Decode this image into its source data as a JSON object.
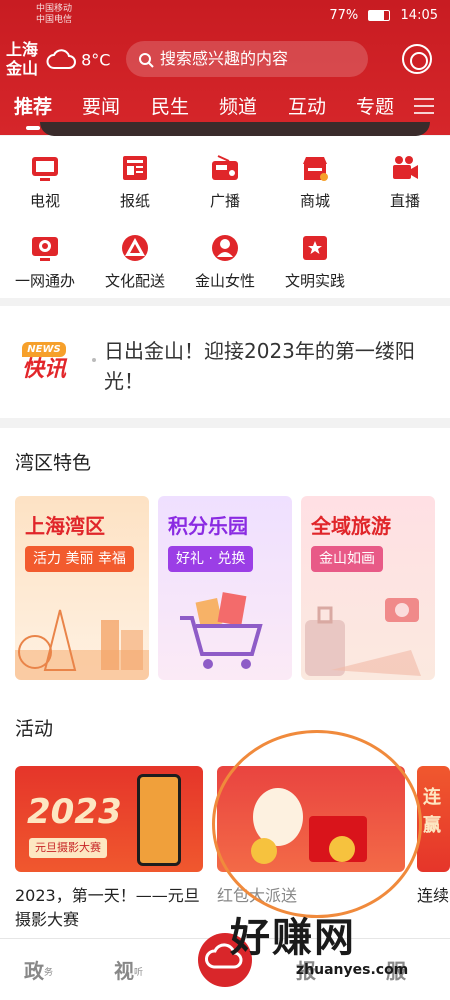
{
  "status_bar": {
    "carrier_1": "中国移动",
    "carrier_2": "中国电信",
    "battery": "77%",
    "time": "14:05"
  },
  "header": {
    "city": "上海金山",
    "temperature": "8°C",
    "weather_icon": "cloud-icon",
    "search_placeholder": "搜索感兴趣的内容"
  },
  "nav_tabs": [
    "推荐",
    "要闻",
    "民生",
    "频道",
    "互动",
    "专题"
  ],
  "grid": {
    "items": [
      {
        "label": "电视",
        "icon": "tv-icon"
      },
      {
        "label": "报纸",
        "icon": "newspaper-icon"
      },
      {
        "label": "广播",
        "icon": "radio-icon"
      },
      {
        "label": "商城",
        "icon": "shop-icon"
      },
      {
        "label": "直播",
        "icon": "camera-icon"
      },
      {
        "label": "一网通办",
        "icon": "service-icon"
      },
      {
        "label": "文化配送",
        "icon": "culture-icon"
      },
      {
        "label": "金山女性",
        "icon": "women-icon"
      },
      {
        "label": "文明实践",
        "icon": "practice-icon"
      }
    ]
  },
  "news": {
    "badge_top": "NEWS",
    "badge_main": "快讯",
    "headline": "日出金山！迎接2023年的第一缕阳光！"
  },
  "bay_section": {
    "title": "湾区特色",
    "tiles": [
      {
        "title": "上海湾区",
        "pill": "活力 美丽 幸福"
      },
      {
        "title": "积分乐园",
        "pill": "好礼 · 兑换"
      },
      {
        "title": "全域旅游",
        "pill": "金山如画"
      }
    ]
  },
  "activity_section": {
    "title": "活动",
    "items": [
      {
        "caption": "2023，第一天！——元旦摄影大赛",
        "banner_text": "2023",
        "banner_sub": "元旦摄影大赛"
      },
      {
        "caption": "红包大派送",
        "banner_text": ""
      },
      {
        "caption": "连续",
        "banner_text": "连赢"
      }
    ]
  },
  "bottom_bar": {
    "items": [
      {
        "label": "政",
        "sub": "务"
      },
      {
        "label": "视",
        "sub": "听"
      },
      {
        "label": "报",
        "sub": ""
      },
      {
        "label": "服",
        "sub": ""
      }
    ]
  },
  "watermark": {
    "main": "好赚网",
    "sub": "zhuanyes.com"
  },
  "colors": {
    "brand_red": "#d6262a",
    "header_red": "#c81c22",
    "annotation_orange": "#f08a3c"
  }
}
